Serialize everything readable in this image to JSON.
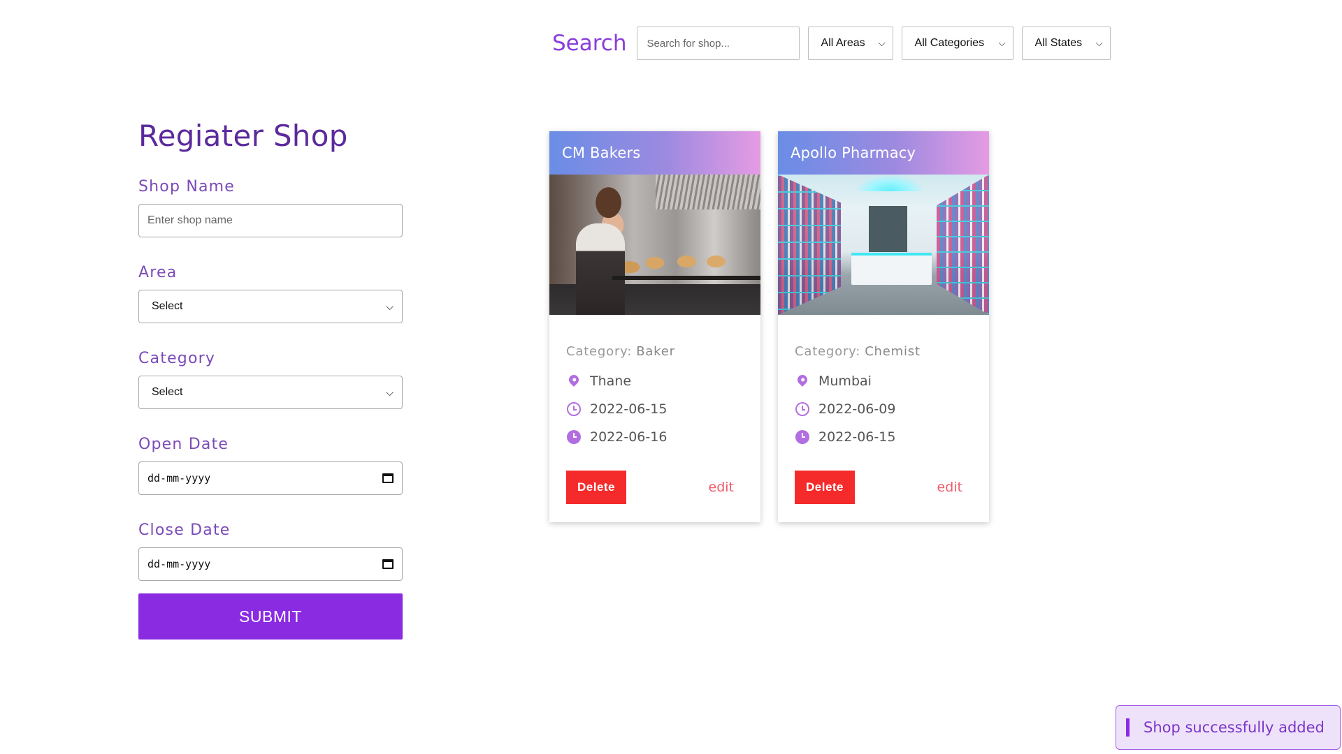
{
  "search": {
    "title": "Search",
    "placeholder": "Search for shop...",
    "filters": {
      "areas": "All Areas",
      "categories": "All Categories",
      "states": "All States"
    }
  },
  "form": {
    "title": "Regiater Shop",
    "shop_name_label": "Shop Name",
    "shop_name_placeholder": "Enter shop name",
    "area_label": "Area",
    "area_value": "Select",
    "category_label": "Category",
    "category_value": "Select",
    "open_date_label": "Open Date",
    "open_date_value": "dd-mm-yyyy",
    "close_date_label": "Close Date",
    "close_date_value": "dd-mm-yyyy",
    "submit_label": "SUBMIT"
  },
  "cards": [
    {
      "title": "CM Bakers",
      "category_label": "Category:",
      "category": "Baker",
      "area": "Thane",
      "open_date": "2022-06-15",
      "close_date": "2022-06-16",
      "delete_label": "Delete",
      "edit_label": "edit"
    },
    {
      "title": "Apollo Pharmacy",
      "category_label": "Category:",
      "category": "Chemist",
      "area": "Mumbai",
      "open_date": "2022-06-09",
      "close_date": "2022-06-15",
      "delete_label": "Delete",
      "edit_label": "edit"
    }
  ],
  "toast": {
    "message": "Shop successfully added"
  },
  "colors": {
    "accent": "#8a2be2",
    "title": "#5b2a9c",
    "delete": "#f52b2b",
    "edit": "#f05c6b",
    "icon": "#b26ee0"
  }
}
